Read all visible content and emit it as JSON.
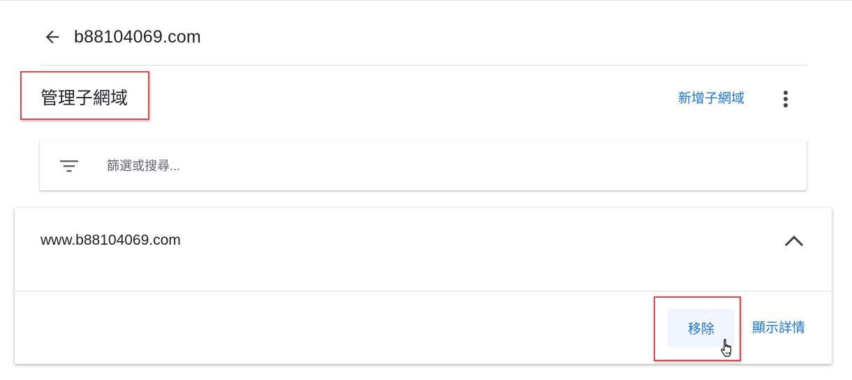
{
  "header": {
    "back_icon": "arrow-back-icon",
    "domain": "b88104069.com"
  },
  "section": {
    "title": "管理子網域",
    "add_label": "新增子網域",
    "more_icon": "more-vert-icon"
  },
  "filter": {
    "icon": "filter-icon",
    "placeholder": "篩選或搜尋...",
    "value": ""
  },
  "subdomains": [
    {
      "domain": "www.b88104069.com",
      "expand_icon": "chevron-up-icon",
      "remove_label": "移除",
      "details_label": "顯示詳情"
    }
  ],
  "colors": {
    "accent": "#1a73e8",
    "highlight": "#e8454a",
    "text": "#202124"
  }
}
